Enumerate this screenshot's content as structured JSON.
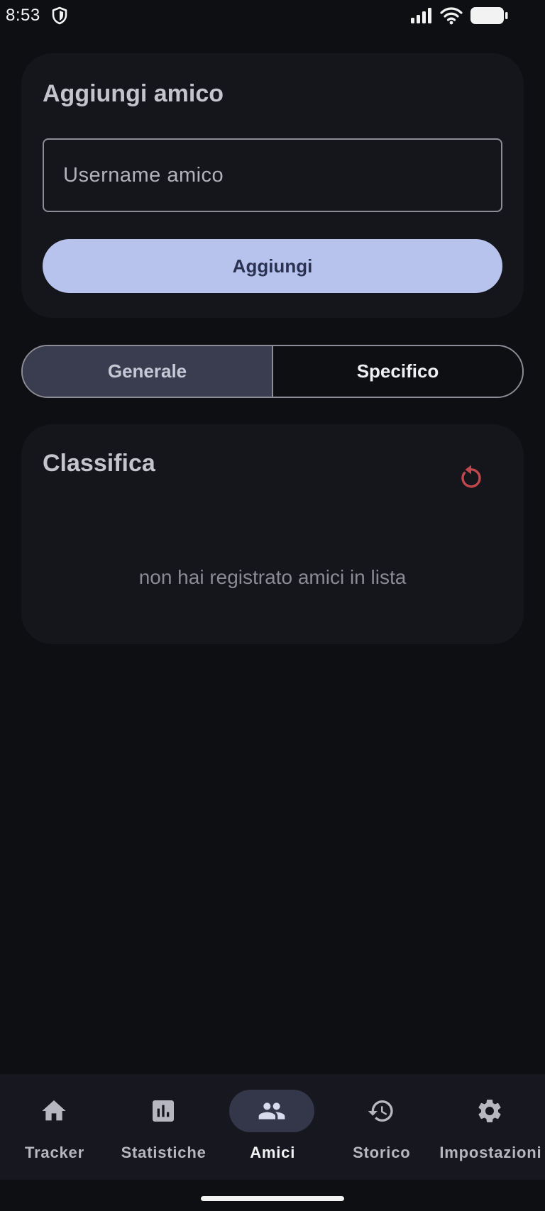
{
  "status_bar": {
    "time": "8:53",
    "icons": [
      "shield-icon",
      "signal-icon",
      "wifi-icon",
      "battery-icon"
    ]
  },
  "add_friend": {
    "title": "Aggiungi amico",
    "input_value": "",
    "input_placeholder": "Username amico",
    "button_label": "Aggiungi"
  },
  "segmented": {
    "options": [
      "Generale",
      "Specifico"
    ],
    "selected": "Generale"
  },
  "ranking": {
    "title": "Classifica",
    "refresh_icon": "refresh-icon",
    "empty_message": "non hai registrato amici in lista"
  },
  "bottom_nav": {
    "items": [
      {
        "label": "Tracker",
        "icon": "home-icon"
      },
      {
        "label": "Statistiche",
        "icon": "bar-chart-icon"
      },
      {
        "label": "Amici",
        "icon": "people-icon"
      },
      {
        "label": "Storico",
        "icon": "history-icon"
      },
      {
        "label": "Impostazioni",
        "icon": "gear-icon"
      }
    ],
    "active": "Amici"
  },
  "colors": {
    "background": "#0e0f13",
    "card": "#15161b",
    "accent": "#b7c3ec",
    "refresh": "#c0484c",
    "nav_background": "#17181f"
  }
}
